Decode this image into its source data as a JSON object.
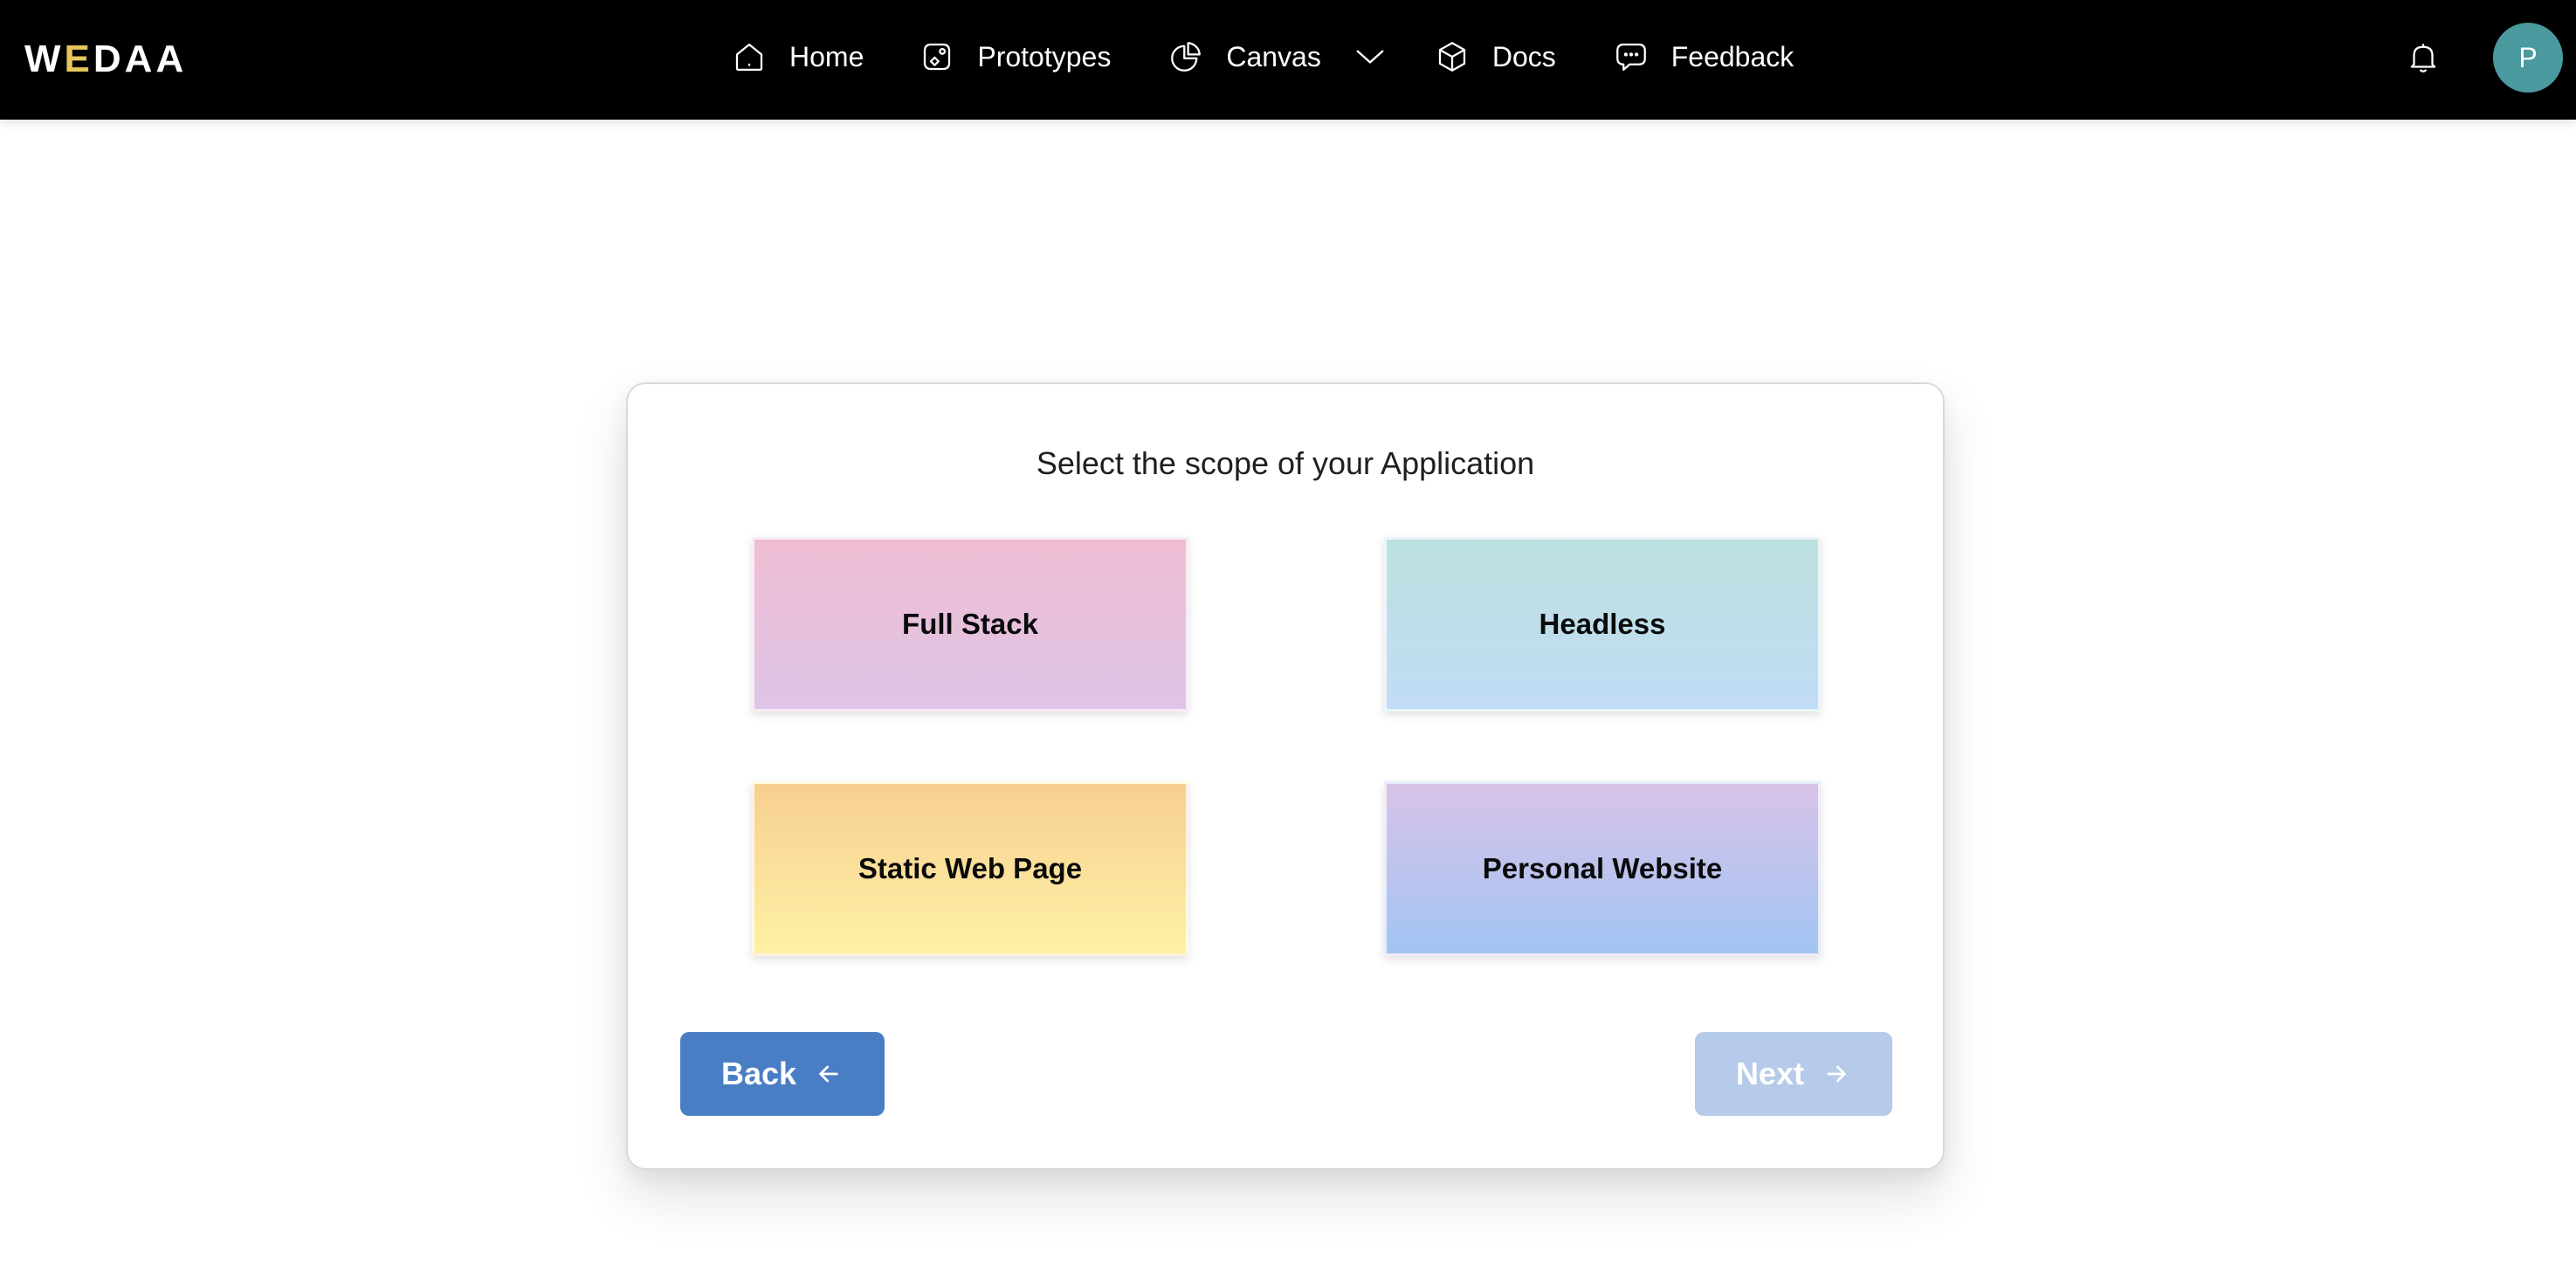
{
  "header": {
    "logo": {
      "part1": "W",
      "accent": "E",
      "part2": "DAA"
    },
    "nav": {
      "home": "Home",
      "prototypes": "Prototypes",
      "canvas": "Canvas",
      "docs": "Docs",
      "feedback": "Feedback"
    },
    "avatar_initial": "P"
  },
  "main": {
    "title": "Select the scope of your Application",
    "options": [
      {
        "label": "Full Stack"
      },
      {
        "label": "Headless"
      },
      {
        "label": "Static Web Page"
      },
      {
        "label": "Personal Website"
      }
    ],
    "back_label": "Back",
    "next_label": "Next"
  },
  "colors": {
    "navbar": "#000000",
    "logo_accent": "#e6c65a",
    "avatar": "#4a9a9f",
    "back_button": "#4a7ec4",
    "next_button_disabled": "#b6cbea"
  },
  "icons": {
    "home": "home-icon",
    "prototypes": "prototypes-icon",
    "canvas": "pie-chart-icon",
    "canvas_dropdown": "chevron-down-icon",
    "docs": "cube-icon",
    "feedback": "chat-bubble-icon",
    "notifications": "bell-icon",
    "back": "arrow-left-icon",
    "next": "arrow-right-icon"
  }
}
